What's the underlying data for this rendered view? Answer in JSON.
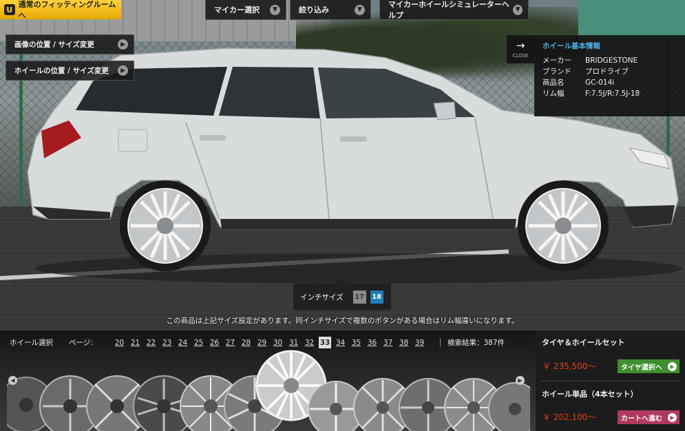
{
  "colors": {
    "fitting_yellow": "#f2bd1b",
    "info_title_blue": "#4db5e8",
    "selected_inch_blue": "#1f7fb6",
    "price_red": "#e8401a",
    "tire_button_green": "#3f8f2f",
    "cart_button_pink": "#b03a5e"
  },
  "top": {
    "fitting_room_label": "通常のフィッティングルームへ",
    "fitting_room_icon": "u-logo-icon",
    "menu_mycar": "マイカー選択",
    "menu_filter": "絞り込み",
    "menu_help": "マイカーホイールシミュレーターヘルプ"
  },
  "side": {
    "image_position": "画像の位置 / サイズ変更",
    "wheel_position": "ホイールの位置 / サイズ変更"
  },
  "info": {
    "close_label": "CLOSE",
    "title": "ホイール基本情報",
    "rows": [
      {
        "k": "メーカー",
        "v": "BRIDGESTONE"
      },
      {
        "k": "ブランド",
        "v": "プロドライブ"
      },
      {
        "k": "商品名",
        "v": "GC-014i"
      },
      {
        "k": "リム幅",
        "v": "F:7.5J/R:7.5J-18"
      }
    ]
  },
  "inch": {
    "label": "インチサイズ",
    "options": [
      "17",
      "18"
    ],
    "selected": "18"
  },
  "notice": "この商品は上記サイズ設定があります。同インチサイズで複数のボタンがある場合はリム幅違いになります。",
  "bottom": {
    "wheel_select_label": "ホイール選択",
    "page_label": "ページ:",
    "pages": [
      "20",
      "21",
      "22",
      "23",
      "24",
      "25",
      "26",
      "27",
      "28",
      "29",
      "30",
      "31",
      "32",
      "33",
      "34",
      "35",
      "36",
      "37",
      "38",
      "39"
    ],
    "current_page": "33",
    "results_label": "検索結果：387件"
  },
  "price": {
    "set_title": "タイヤ＆ホイールセット",
    "set_price": "￥ 235,500〜",
    "set_button": "タイヤ選択へ",
    "single_title": "ホイール単品（4本セット）",
    "single_price": "￥ 202,100〜",
    "single_button": "カートへ進む"
  }
}
